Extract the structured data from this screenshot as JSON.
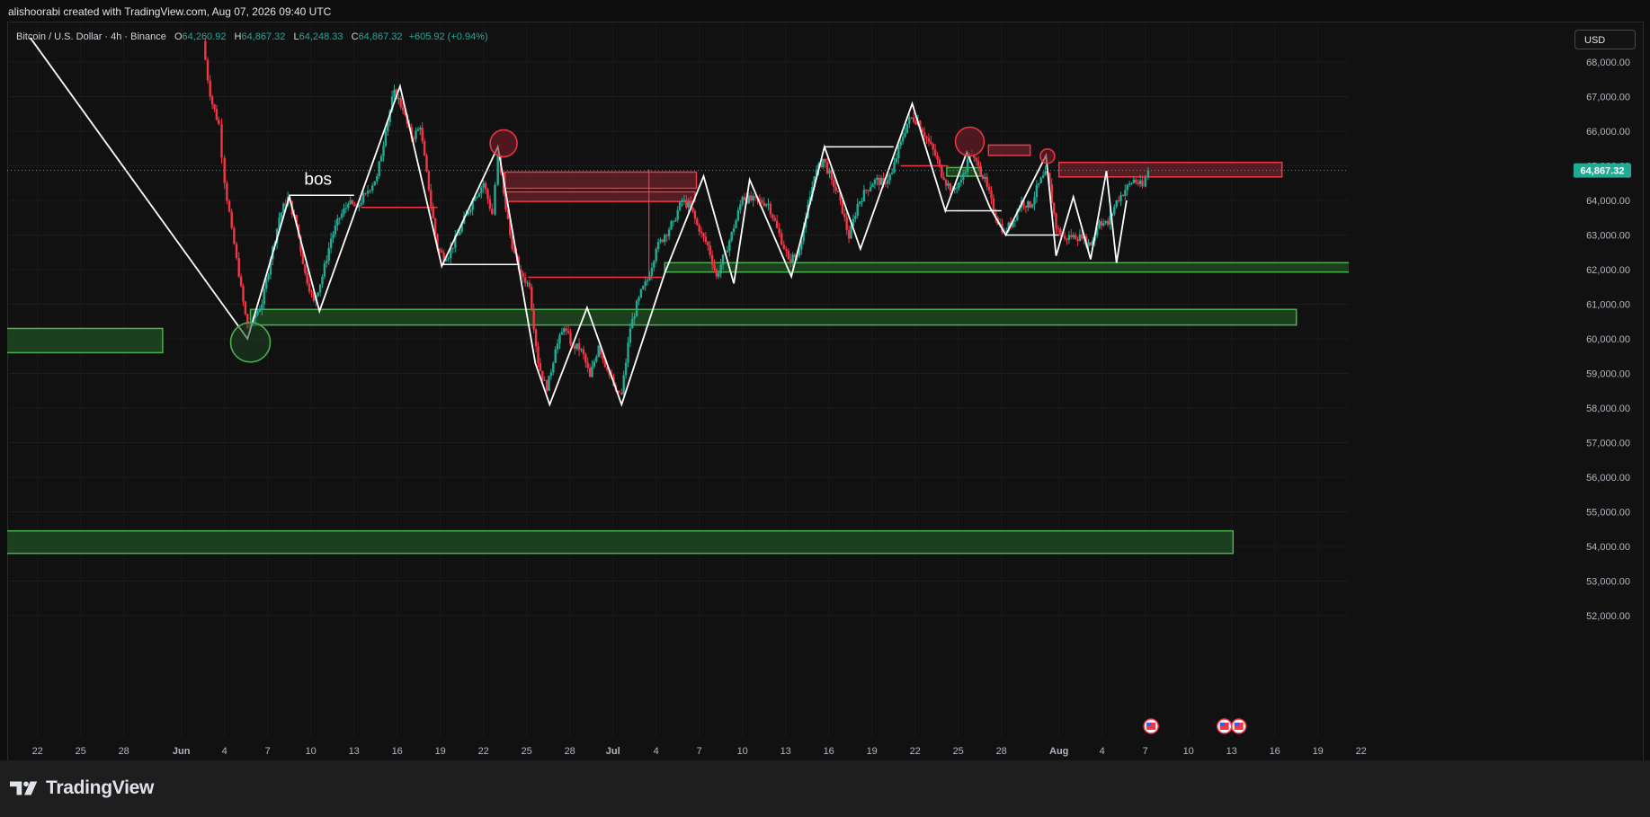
{
  "header": {
    "author_line": "alishoorabi created with TradingView.com, Aug 07, 2026 09:40 UTC"
  },
  "legend": {
    "symbol": "Bitcoin / U.S. Dollar · 4h · Binance",
    "o_label": "O",
    "o_value": "64,260.92",
    "h_label": "H",
    "h_value": "64,867.32",
    "l_label": "L",
    "l_value": "64,248.33",
    "c_label": "C",
    "c_value": "64,867.32",
    "change": "+605.92 (+0.94%)"
  },
  "currency_button": "USD",
  "footer": {
    "brand": "TradingView"
  },
  "colors": {
    "bull": "#22ab94",
    "bear": "#f23645",
    "demand_fill": "#1e4620",
    "demand_stroke": "#4caf50",
    "supply_fill": "#5c1f26",
    "supply_stroke": "#f23645",
    "price_badge": "#22ab94"
  },
  "chart_data": {
    "type": "candlestick",
    "symbol": "BTCUSD",
    "timeframe": "4h",
    "ylim": [
      51500,
      68700
    ],
    "y_ticks": [
      {
        "value": 68000,
        "label": "68,000.00"
      },
      {
        "value": 67000,
        "label": "67,000.00"
      },
      {
        "value": 66000,
        "label": "66,000.00"
      },
      {
        "value": 65000,
        "label": "65,000.00"
      },
      {
        "value": 64000,
        "label": "64,000.00"
      },
      {
        "value": 63000,
        "label": "63,000.00"
      },
      {
        "value": 62000,
        "label": "62,000.00"
      },
      {
        "value": 61000,
        "label": "61,000.00"
      },
      {
        "value": 60000,
        "label": "60,000.00"
      },
      {
        "value": 59000,
        "label": "59,000.00"
      },
      {
        "value": 58000,
        "label": "58,000.00"
      },
      {
        "value": 57000,
        "label": "57,000.00"
      },
      {
        "value": 56000,
        "label": "56,000.00"
      },
      {
        "value": 55000,
        "label": "55,000.00"
      },
      {
        "value": 54000,
        "label": "54,000.00"
      },
      {
        "value": 53000,
        "label": "53,000.00"
      },
      {
        "value": 52000,
        "label": "52,000.00"
      }
    ],
    "x_ticks": [
      {
        "day": -10,
        "label": "22"
      },
      {
        "day": -7,
        "label": "25"
      },
      {
        "day": -4,
        "label": "28"
      },
      {
        "day": 0,
        "label": "Jun"
      },
      {
        "day": 3,
        "label": "4"
      },
      {
        "day": 6,
        "label": "7"
      },
      {
        "day": 9,
        "label": "10"
      },
      {
        "day": 12,
        "label": "13"
      },
      {
        "day": 15,
        "label": "16"
      },
      {
        "day": 18,
        "label": "19"
      },
      {
        "day": 21,
        "label": "22"
      },
      {
        "day": 24,
        "label": "25"
      },
      {
        "day": 27,
        "label": "28"
      },
      {
        "day": 30,
        "label": "Jul"
      },
      {
        "day": 33,
        "label": "4"
      },
      {
        "day": 36,
        "label": "7"
      },
      {
        "day": 39,
        "label": "10"
      },
      {
        "day": 42,
        "label": "13"
      },
      {
        "day": 45,
        "label": "16"
      },
      {
        "day": 48,
        "label": "19"
      },
      {
        "day": 51,
        "label": "22"
      },
      {
        "day": 54,
        "label": "25"
      },
      {
        "day": 57,
        "label": "28"
      },
      {
        "day": 61,
        "label": "Aug"
      },
      {
        "day": 64,
        "label": "4"
      },
      {
        "day": 67,
        "label": "7"
      },
      {
        "day": 70,
        "label": "10"
      },
      {
        "day": 73,
        "label": "13"
      },
      {
        "day": 76,
        "label": "16"
      },
      {
        "day": 79,
        "label": "19"
      },
      {
        "day": 82,
        "label": "22"
      }
    ],
    "last_price": 64867.32,
    "last_price_label": "64,867.32",
    "price_path": [
      [
        1.5,
        68600
      ],
      [
        2.0,
        67000
      ],
      [
        2.6,
        66200
      ],
      [
        3.0,
        64500
      ],
      [
        3.5,
        63200
      ],
      [
        4.0,
        61800
      ],
      [
        4.6,
        60300
      ],
      [
        5.0,
        60600
      ],
      [
        5.6,
        61000
      ],
      [
        6.2,
        62300
      ],
      [
        6.8,
        63500
      ],
      [
        7.4,
        64100
      ],
      [
        8.0,
        63300
      ],
      [
        8.6,
        61900
      ],
      [
        9.2,
        61100
      ],
      [
        9.8,
        61800
      ],
      [
        10.4,
        62900
      ],
      [
        11.0,
        63500
      ],
      [
        11.6,
        63900
      ],
      [
        12.2,
        63800
      ],
      [
        12.8,
        64200
      ],
      [
        13.6,
        64700
      ],
      [
        14.2,
        66000
      ],
      [
        14.8,
        67200
      ],
      [
        15.4,
        66600
      ],
      [
        16.0,
        65800
      ],
      [
        16.6,
        66100
      ],
      [
        17.2,
        64300
      ],
      [
        17.8,
        62600
      ],
      [
        18.4,
        62300
      ],
      [
        19.2,
        63000
      ],
      [
        19.8,
        63600
      ],
      [
        20.4,
        64100
      ],
      [
        21.0,
        64500
      ],
      [
        21.6,
        63600
      ],
      [
        22.0,
        65300
      ],
      [
        22.4,
        64200
      ],
      [
        23.0,
        62600
      ],
      [
        23.6,
        61900
      ],
      [
        24.2,
        61500
      ],
      [
        24.8,
        59300
      ],
      [
        25.4,
        58500
      ],
      [
        26.0,
        59700
      ],
      [
        26.6,
        60300
      ],
      [
        27.2,
        59800
      ],
      [
        27.8,
        59700
      ],
      [
        28.4,
        58900
      ],
      [
        29.0,
        59800
      ],
      [
        29.6,
        59100
      ],
      [
        30.2,
        58500
      ],
      [
        30.6,
        58400
      ],
      [
        31.2,
        60300
      ],
      [
        31.8,
        61200
      ],
      [
        32.4,
        61700
      ],
      [
        33.0,
        62600
      ],
      [
        33.6,
        63000
      ],
      [
        34.2,
        63400
      ],
      [
        34.8,
        64000
      ],
      [
        35.4,
        63800
      ],
      [
        36.0,
        63100
      ],
      [
        36.6,
        62700
      ],
      [
        37.2,
        61800
      ],
      [
        37.8,
        62500
      ],
      [
        38.4,
        63200
      ],
      [
        39.0,
        64100
      ],
      [
        39.6,
        64000
      ],
      [
        40.2,
        64000
      ],
      [
        40.8,
        63900
      ],
      [
        41.4,
        63200
      ],
      [
        42.2,
        62300
      ],
      [
        42.8,
        62400
      ],
      [
        43.4,
        63500
      ],
      [
        44.0,
        64700
      ],
      [
        44.6,
        65200
      ],
      [
        45.2,
        64600
      ],
      [
        45.8,
        64000
      ],
      [
        46.4,
        62900
      ],
      [
        47.0,
        63900
      ],
      [
        47.6,
        64300
      ],
      [
        48.2,
        64600
      ],
      [
        48.8,
        64500
      ],
      [
        49.4,
        64800
      ],
      [
        50.0,
        65700
      ],
      [
        50.6,
        66400
      ],
      [
        51.2,
        66300
      ],
      [
        51.8,
        65800
      ],
      [
        52.4,
        65300
      ],
      [
        53.0,
        64600
      ],
      [
        53.6,
        64300
      ],
      [
        54.2,
        64600
      ],
      [
        54.8,
        65300
      ],
      [
        55.4,
        65000
      ],
      [
        56.0,
        64400
      ],
      [
        56.6,
        63500
      ],
      [
        57.2,
        63100
      ],
      [
        57.8,
        63400
      ],
      [
        58.4,
        64000
      ],
      [
        59.0,
        63800
      ],
      [
        59.6,
        64500
      ],
      [
        60.2,
        64800
      ],
      [
        60.8,
        63200
      ],
      [
        61.4,
        62900
      ],
      [
        62.0,
        63000
      ],
      [
        62.6,
        62900
      ],
      [
        63.2,
        62700
      ],
      [
        63.8,
        63400
      ],
      [
        64.4,
        63300
      ],
      [
        65.0,
        64000
      ],
      [
        65.6,
        64300
      ],
      [
        66.2,
        64600
      ],
      [
        66.8,
        64400
      ],
      [
        67.2,
        64867
      ]
    ],
    "zones": [
      {
        "kind": "demand",
        "x0": -12.5,
        "x1": -1.3,
        "y_high": 60300,
        "y_low": 59600
      },
      {
        "kind": "demand",
        "x0": 4.8,
        "x1": 77.5,
        "y_high": 60850,
        "y_low": 60400
      },
      {
        "kind": "demand",
        "x0": 33.6,
        "x1": 82.0,
        "y_high": 62200,
        "y_low": 61930
      },
      {
        "kind": "demand",
        "x0": -12.5,
        "x1": 73.1,
        "y_high": 54450,
        "y_low": 53800
      },
      {
        "kind": "demand",
        "x0": 53.2,
        "x1": 55.6,
        "y_high": 64950,
        "y_low": 64700
      },
      {
        "kind": "supply",
        "x0": 22.5,
        "x1": 35.8,
        "y_high": 64820,
        "y_low": 64350
      },
      {
        "kind": "supply",
        "x0": 22.5,
        "x1": 35.7,
        "y_high": 64250,
        "y_low": 63970
      },
      {
        "kind": "supply",
        "x0": 56.1,
        "x1": 59.0,
        "y_high": 65600,
        "y_low": 65300
      },
      {
        "kind": "supply",
        "x0": 61.0,
        "x1": 76.5,
        "y_high": 65100,
        "y_low": 64680
      }
    ],
    "structure_lines": [
      [
        [
          -10.5,
          68700
        ],
        [
          4.6,
          60000
        ],
        [
          7.5,
          64100
        ],
        [
          9.6,
          60800
        ],
        [
          15.2,
          67300
        ],
        [
          18.1,
          62100
        ],
        [
          22.0,
          65550
        ],
        [
          24.6,
          59300
        ],
        [
          25.6,
          58100
        ],
        [
          28.2,
          60900
        ],
        [
          30.6,
          58100
        ],
        [
          33.6,
          61900
        ],
        [
          36.3,
          64700
        ],
        [
          38.4,
          61600
        ],
        [
          39.5,
          64600
        ],
        [
          42.4,
          61800
        ],
        [
          44.7,
          65550
        ],
        [
          47.2,
          62600
        ],
        [
          50.8,
          66800
        ],
        [
          53.1,
          63700
        ],
        [
          54.6,
          65400
        ],
        [
          56.2,
          63800
        ],
        [
          57.3,
          63000
        ],
        [
          60.1,
          65300
        ],
        [
          60.8,
          62400
        ],
        [
          62.0,
          64100
        ],
        [
          63.2,
          62300
        ],
        [
          64.3,
          64850
        ],
        [
          65.0,
          62200
        ],
        [
          65.7,
          64000
        ]
      ]
    ],
    "level_lines": [
      {
        "color": "white",
        "x0": 7.5,
        "x1": 12.0,
        "y": 64150
      },
      {
        "color": "white",
        "x0": 18.1,
        "x1": 23.5,
        "y": 62150
      },
      {
        "color": "white",
        "x0": 44.7,
        "x1": 49.5,
        "y": 65550
      },
      {
        "color": "white",
        "x0": 53.1,
        "x1": 57.0,
        "y": 63700
      },
      {
        "color": "white",
        "x0": 57.3,
        "x1": 61.0,
        "y": 63000
      },
      {
        "color": "red",
        "x0": 12.5,
        "x1": 17.8,
        "y": 63800
      },
      {
        "color": "red",
        "x0": 24.1,
        "x1": 33.4,
        "y": 61780
      },
      {
        "color": "red",
        "x0": 50.0,
        "x1": 53.3,
        "y": 65000
      },
      {
        "color": "red",
        "x0": 32.5,
        "x1": 32.5,
        "y0": 61780,
        "y1": 64900
      }
    ],
    "markers": [
      {
        "kind": "demand",
        "x": 4.8,
        "y": 59900,
        "r": 22
      },
      {
        "kind": "supply",
        "x": 22.4,
        "y": 65650,
        "r": 15
      },
      {
        "kind": "supply",
        "x": 54.8,
        "y": 65700,
        "r": 16
      },
      {
        "kind": "supply",
        "x": 60.2,
        "y": 65280,
        "r": 8
      }
    ],
    "annotations": [
      {
        "text": "bos",
        "x": 9.5,
        "y": 64450
      }
    ],
    "events": [
      {
        "icon": "us-flag-icon",
        "day": 67.4
      },
      {
        "icon": "us-flag-icon",
        "day": 72.5
      },
      {
        "icon": "us-flag-icon",
        "day": 73.5
      }
    ]
  }
}
